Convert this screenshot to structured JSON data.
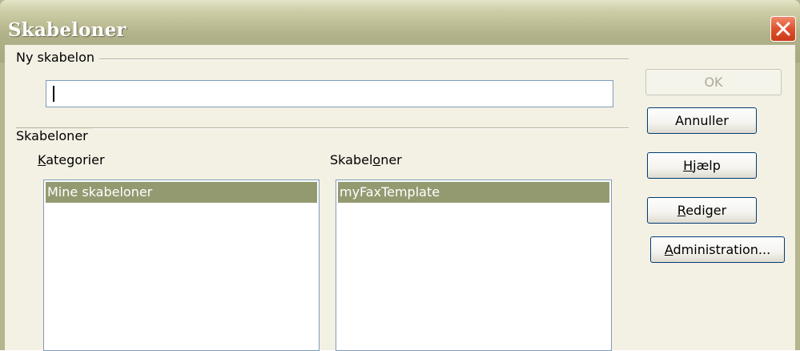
{
  "window": {
    "title": "Skabeloner"
  },
  "new_template": {
    "group_label": "Ny skabelon",
    "name_value": ""
  },
  "templates_group": {
    "group_label": "Skabeloner",
    "categories_label_pre": "",
    "categories_label_u": "K",
    "categories_label_post": "ategorier",
    "templates_label_pre": "Skabel",
    "templates_label_u": "o",
    "templates_label_post": "ner",
    "categories": [
      "Mine skabeloner"
    ],
    "templates": [
      "myFaxTemplate"
    ]
  },
  "buttons": {
    "ok": "OK",
    "cancel": "Annuller",
    "help_u": "H",
    "help_rest": "jælp",
    "edit_u": "R",
    "edit_rest": "ediger",
    "admin_u": "A",
    "admin_rest": "dministration..."
  },
  "colors": {
    "title_bar": "#b1b18a",
    "selection": "#939a70",
    "close_button": "#e0512e"
  },
  "icons": {
    "close": "close-icon"
  }
}
